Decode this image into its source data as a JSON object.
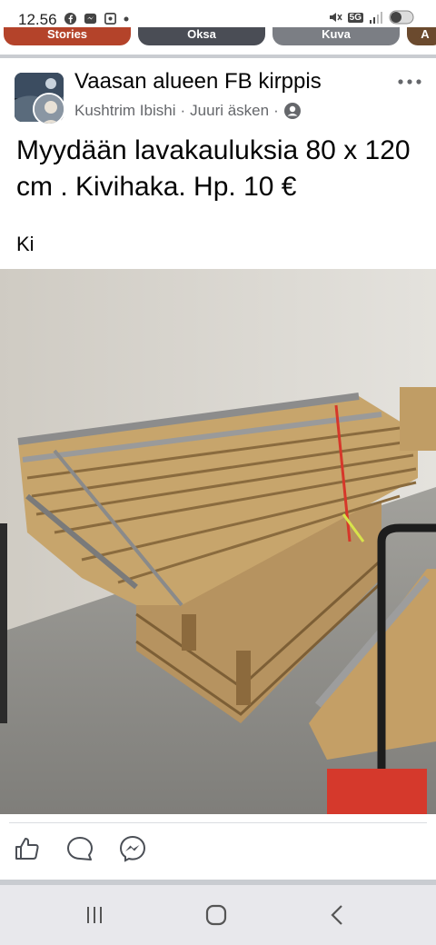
{
  "status_bar": {
    "time": "12.56",
    "network": "5G"
  },
  "stories": [
    {
      "label": "Stories"
    },
    {
      "label": "Oksa"
    },
    {
      "label": "Kuva"
    },
    {
      "label": "A"
    }
  ],
  "post": {
    "group_name": "Vaasan alueen FB kirppis",
    "author": "Kushtrim Ibishi",
    "separator": "·",
    "time": "Juuri äsken",
    "title": "Myydään lavakauluksia 80 x 120 cm . Kivihaka. Hp. 10 €",
    "body": "Ki"
  },
  "icons": {
    "more": "more-dots-icon",
    "like": "thumbs-up-icon",
    "comment": "comment-icon",
    "share": "messenger-icon",
    "audience": "members-icon"
  },
  "colors": {
    "text_primary": "#050505",
    "text_secondary": "#65676b",
    "divider": "#c9ccd1"
  }
}
